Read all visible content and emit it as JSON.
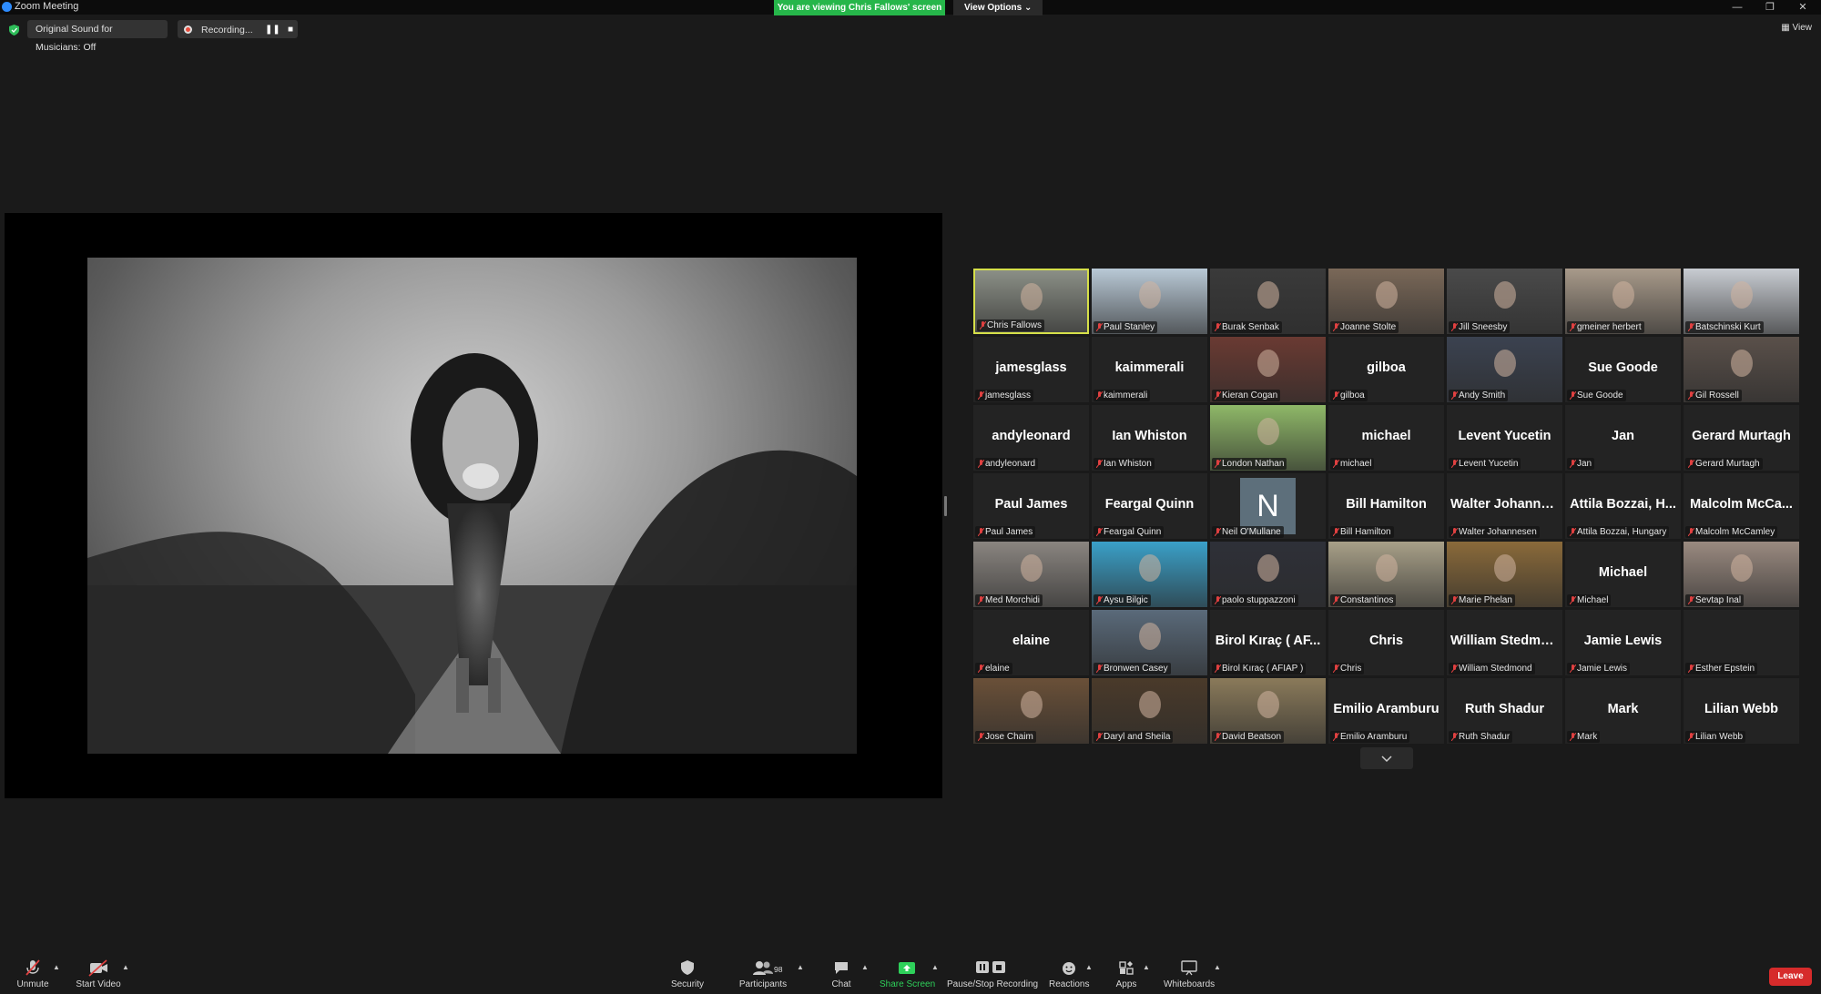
{
  "window": {
    "title": "Zoom Meeting"
  },
  "banner": {
    "viewing_text": "You are viewing Chris Fallows' screen",
    "view_options": "View Options ⌄"
  },
  "status": {
    "original_sound": "Original Sound for Musicians: Off",
    "recording": "Recording...",
    "view_label": "View"
  },
  "participants": [
    {
      "big": "",
      "label": "Chris Fallows",
      "video": true,
      "active": true,
      "bg": "#8b8f86"
    },
    {
      "big": "",
      "label": "Paul Stanley",
      "video": true,
      "bg": "#b9c9d6"
    },
    {
      "big": "",
      "label": "Burak Senbak",
      "video": true,
      "bg": "#3a3a3a"
    },
    {
      "big": "",
      "label": "Joanne Stolte",
      "video": true,
      "bg": "#7a6858"
    },
    {
      "big": "",
      "label": "Jill Sneesby",
      "video": true,
      "bg": "#4a4a4a"
    },
    {
      "big": "",
      "label": "gmeiner herbert",
      "video": true,
      "bg": "#a89a8a"
    },
    {
      "big": "",
      "label": "Batschinski Kurt",
      "video": true,
      "bg": "#c8ccd2"
    },
    {
      "big": "jamesglass",
      "label": "jamesglass"
    },
    {
      "big": "kaimmerali",
      "label": "kaimmerali"
    },
    {
      "big": "",
      "label": "Kieran Cogan",
      "video": true,
      "bg": "#6a3a32"
    },
    {
      "big": "gilboa",
      "label": "gilboa"
    },
    {
      "big": "",
      "label": "Andy Smith",
      "video": true,
      "bg": "#3b4250"
    },
    {
      "big": "Sue Goode",
      "label": "Sue Goode"
    },
    {
      "big": "",
      "label": "Gil Rossell",
      "video": true,
      "bg": "#5a504a"
    },
    {
      "big": "andyleonard",
      "label": "andyleonard"
    },
    {
      "big": "Ian Whiston",
      "label": "Ian Whiston"
    },
    {
      "big": "",
      "label": "London Nathan",
      "video": true,
      "bg": "#8fb868"
    },
    {
      "big": "michael",
      "label": "michael"
    },
    {
      "big": "Levent Yucetin",
      "label": "Levent Yucetin"
    },
    {
      "big": "Jan",
      "label": "Jan"
    },
    {
      "big": "Gerard Murtagh",
      "label": "Gerard Murtagh"
    },
    {
      "big": "Paul James",
      "label": "Paul James"
    },
    {
      "big": "Feargal Quinn",
      "label": "Feargal Quinn"
    },
    {
      "big": "",
      "label": "Neil O'Mullane",
      "letter": "N"
    },
    {
      "big": "Bill Hamilton",
      "label": "Bill Hamilton"
    },
    {
      "big": "Walter Johanne...",
      "label": "Walter Johannesen"
    },
    {
      "big": "Attila Bozzai, H...",
      "label": "Attila Bozzai, Hungary"
    },
    {
      "big": "Malcolm McCa...",
      "label": "Malcolm McCamley"
    },
    {
      "big": "",
      "label": "Med Morchidi",
      "video": true,
      "bg": "#8a8580"
    },
    {
      "big": "",
      "label": "Aysu Bilgic",
      "video": true,
      "bg": "#3aa0c8"
    },
    {
      "big": "",
      "label": "paolo stuppazzoni",
      "video": true,
      "bg": "#2e3038"
    },
    {
      "big": "",
      "label": "Constantinos",
      "video": true,
      "bg": "#a8a088"
    },
    {
      "big": "",
      "label": "Marie Phelan",
      "video": true,
      "bg": "#8a6a3a"
    },
    {
      "big": "Michael",
      "label": "Michael"
    },
    {
      "big": "",
      "label": "Sevtap Inal",
      "video": true,
      "bg": "#9a8a80"
    },
    {
      "big": "elaine",
      "label": "elaine"
    },
    {
      "big": "",
      "label": "Bronwen Casey",
      "video": true,
      "bg": "#5a6a7a"
    },
    {
      "big": "Birol Kıraç ( AF...",
      "label": "Birol Kıraç ( AFIAP )"
    },
    {
      "big": "Chris",
      "label": "Chris"
    },
    {
      "big": "William Stedmo...",
      "label": "William Stedmond"
    },
    {
      "big": "Jamie Lewis",
      "label": "Jamie Lewis"
    },
    {
      "big": "",
      "label": "Esther Epstein"
    },
    {
      "big": "",
      "label": "Jose Chaim",
      "video": true,
      "bg": "#6a5038"
    },
    {
      "big": "",
      "label": "Daryl and Sheila",
      "video": true,
      "bg": "#4a3a2a"
    },
    {
      "big": "",
      "label": "David Beatson",
      "video": true,
      "bg": "#8a7a5a"
    },
    {
      "big": "Emilio Aramburu",
      "label": "Emilio Aramburu"
    },
    {
      "big": "Ruth Shadur",
      "label": "Ruth Shadur"
    },
    {
      "big": "Mark",
      "label": "Mark"
    },
    {
      "big": "Lilian Webb",
      "label": "Lilian Webb"
    }
  ],
  "toolbar": {
    "unmute": "Unmute",
    "start_video": "Start Video",
    "security": "Security",
    "participants": "Participants",
    "participant_count": "98",
    "chat": "Chat",
    "share_screen": "Share Screen",
    "pause_stop": "Pause/Stop Recording",
    "reactions": "Reactions",
    "apps": "Apps",
    "whiteboards": "Whiteboards",
    "leave": "Leave"
  },
  "colors": {
    "accent_green": "#26b64a",
    "leave_red": "#d62b2b",
    "active_border": "#d6e04a"
  }
}
